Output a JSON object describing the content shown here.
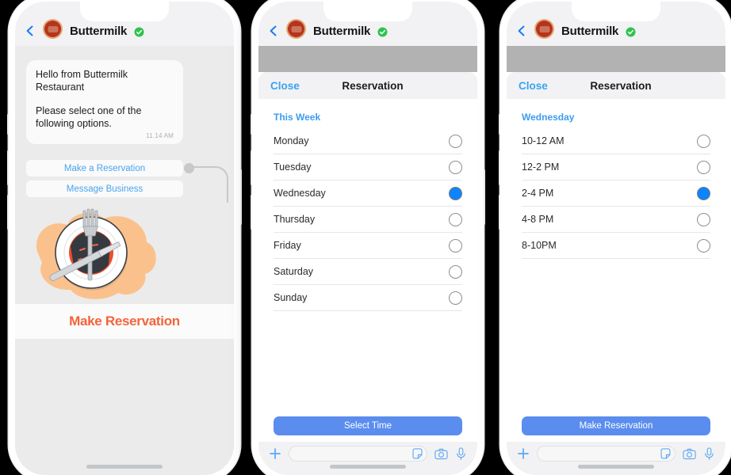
{
  "header": {
    "back_icon": "chevron-left-icon",
    "avatar_icon": "buttermilk-logo-avatar",
    "business_name": "Buttermilk",
    "verified_icon": "verified-badge-icon",
    "verified_color": "#2fc34f"
  },
  "phone1": {
    "message": {
      "line1": "Hello from Buttermilk Restaurant",
      "line2": "Please select one of the following options.",
      "timestamp": "11.14 AM"
    },
    "actions": [
      {
        "label": "Make a Reservation"
      },
      {
        "label": "Message Business"
      }
    ],
    "illustration": {
      "name": "plate-with-fork-and-knife-illustration",
      "blob_color": "#fbc18d",
      "plate_color": "#ffffff",
      "food_color": "#ef4b2a",
      "utensil_color": "#c9ccd0"
    },
    "cta": {
      "label": "Make Reservation",
      "color": "#f4633a"
    }
  },
  "phone2": {
    "sheet": {
      "close_label": "Close",
      "title": "Reservation",
      "section_header": "This Week",
      "options": [
        {
          "label": "Monday",
          "selected": false
        },
        {
          "label": "Tuesday",
          "selected": false
        },
        {
          "label": "Wednesday",
          "selected": true
        },
        {
          "label": "Thursday",
          "selected": false
        },
        {
          "label": "Friday",
          "selected": false
        },
        {
          "label": "Saturday",
          "selected": false
        },
        {
          "label": "Sunday",
          "selected": false
        }
      ],
      "primary_button": "Select Time",
      "primary_button_color": "#5b8def"
    }
  },
  "phone3": {
    "sheet": {
      "close_label": "Close",
      "title": "Reservation",
      "section_header": "Wednesday",
      "options": [
        {
          "label": "10-12 AM",
          "selected": false
        },
        {
          "label": "12-2 PM",
          "selected": false
        },
        {
          "label": "2-4 PM",
          "selected": true
        },
        {
          "label": "4-8 PM",
          "selected": false
        },
        {
          "label": "8-10PM",
          "selected": false
        }
      ],
      "primary_button": "Make Reservation",
      "primary_button_color": "#5b8def"
    }
  },
  "inputbar": {
    "add_icon": "plus-icon",
    "text_placeholder": "",
    "sticker_icon": "sticker-icon",
    "camera_icon": "camera-icon",
    "mic_icon": "microphone-icon"
  }
}
